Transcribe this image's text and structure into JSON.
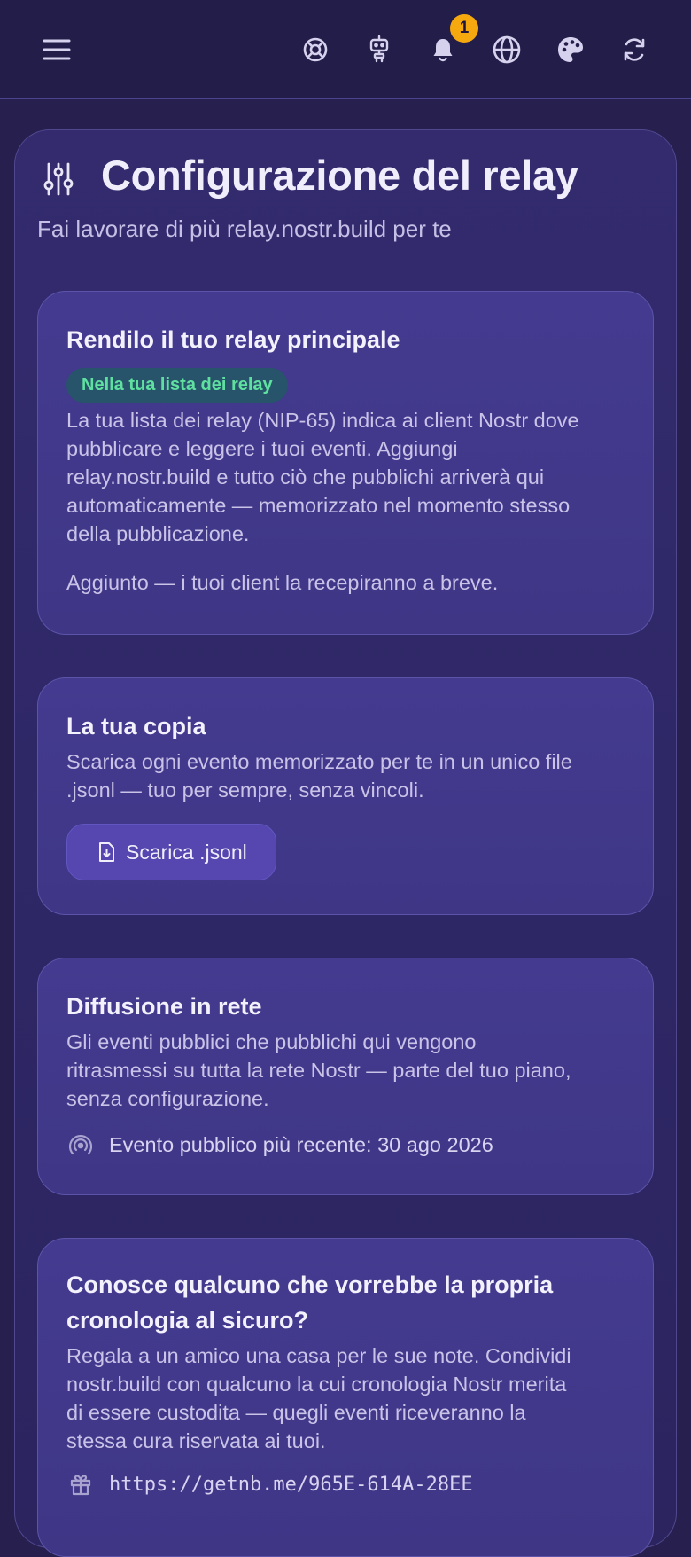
{
  "toolbar": {
    "menu_icon": "hamburger-menu-icon",
    "icons": [
      "lifebuoy-icon",
      "robot-icon",
      "bell-icon",
      "globe-icon",
      "palette-icon",
      "refresh-icon"
    ],
    "notification_count": "1"
  },
  "page": {
    "title": "Configurazione del relay",
    "subtitle": "Fai lavorare di più relay.nostr.build per te",
    "title_icon": "sliders-icon"
  },
  "cards": {
    "primary": {
      "heading": "Rendilo il tuo relay principale",
      "badge": "Nella tua lista dei relay",
      "line1": "La tua lista dei relay (NIP-65) indica ai client Nostr dove",
      "line2": "pubblicare e leggere i tuoi eventi. Aggiungi",
      "line3": "relay.nostr.build e tutto ciò che pubblichi arriverà qui",
      "line4": "automaticamente — memorizzato nel momento stesso",
      "line5": "della pubblicazione.",
      "status": "Aggiunto — i tuoi client la recepiranno a breve."
    },
    "copy": {
      "heading": "La tua copia",
      "line1": "Scarica ogni evento memorizzato per te in un unico file",
      "line2": ".jsonl — tuo per sempre, senza vincoli.",
      "button_label": "Scarica .jsonl",
      "button_icon": "file-download-icon"
    },
    "broadcast": {
      "heading": "Diffusione in rete",
      "line1": "Gli eventi pubblici che pubblichi qui vengono",
      "line2": "ritrasmessi su tutta la rete Nostr — parte del tuo piano,",
      "line3": "senza configurazione.",
      "latest": "Evento pubblico più recente: 30 ago 2026",
      "latest_icon": "broadcast-icon"
    },
    "gift": {
      "heading_line1": "Conosce qualcuno che vorrebbe la propria",
      "heading_line2": "cronologia al sicuro?",
      "line1": "Regala a un amico una casa per le sue note. Condividi",
      "line2": "nostr.build con qualcuno la cui cronologia Nostr merita",
      "line3": "di essere custodita — quegli eventi riceveranno la",
      "line4": "stessa cura riservata ai tuoi.",
      "link": "https://getnb.me/965E-614A-28EE",
      "link_icon": "gift-icon"
    }
  },
  "colors": {
    "background": "#27204f",
    "card": "#413889",
    "accent_button": "#5546b0",
    "badge_bg": "#27546a",
    "badge_text": "#5fe0a0",
    "notification": "#f5a90f"
  }
}
